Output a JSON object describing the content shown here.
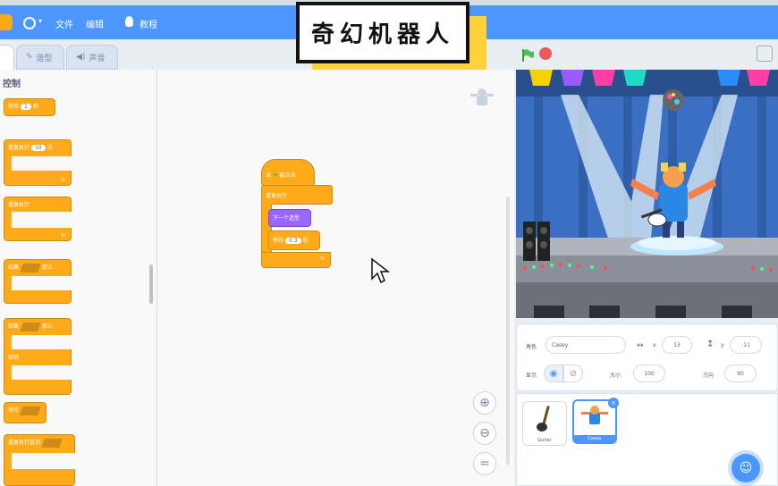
{
  "overlay_title": "奇幻机器人",
  "menu": {
    "file": "文件",
    "edit": "编辑",
    "tutorials": "教程"
  },
  "tabs": {
    "costumes": "造型",
    "sounds": "声音"
  },
  "palette": {
    "category": "控制",
    "blocks": {
      "wait": "等待",
      "wait_unit": "秒",
      "wait_value": "1",
      "repeat": "重复执行",
      "repeat_value": "10",
      "repeat_unit": "次",
      "forever": "重复执行",
      "if": "如果",
      "then": "那么",
      "else": "否则",
      "wait_until": "等待",
      "repeat_until": "重复执行直到"
    }
  },
  "script": {
    "hat": "当",
    "hat_suffix": "被点击",
    "forever": "重复执行",
    "next_costume": "下一个造型",
    "wait": "等待",
    "wait_value": "0.3",
    "wait_unit": "秒"
  },
  "sprite_info": {
    "sprite_label": "角色",
    "sprite_name": "Casey",
    "x_label": "x",
    "x_value": "13",
    "y_label": "y",
    "y_value": "-11",
    "show_label": "显示",
    "size_label": "大小",
    "size_value": "100",
    "direction_label": "方向",
    "direction_value": "90"
  },
  "sprites": [
    {
      "name": "Guitar"
    },
    {
      "name": "Casey"
    }
  ],
  "colors": {
    "menubar": "#4c97ff",
    "control_block": "#ffab19",
    "looks_block": "#9966ff",
    "accent": "#4c97ff"
  },
  "icons": [
    "globe-icon",
    "lightbulb-icon",
    "green-flag-icon",
    "stop-icon",
    "fullscreen-icon",
    "zoom-in-icon",
    "zoom-out-icon",
    "zoom-reset-icon",
    "eye-icon",
    "eye-hidden-icon",
    "add-sprite-icon",
    "delete-icon"
  ]
}
